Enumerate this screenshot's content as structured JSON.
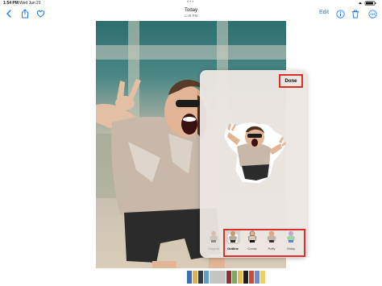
{
  "status_bar": {
    "time": "1:54 PM",
    "date": "Wed Jun 21",
    "right": ""
  },
  "nav": {
    "title": "Today",
    "subtitle": "1:48 PM",
    "edit_label": "Edit",
    "icons": [
      "back-chevron-icon",
      "share-icon",
      "heart-icon",
      "info-icon",
      "trash-icon",
      "more-icon"
    ]
  },
  "sticker_panel": {
    "done_label": "Done",
    "styles": [
      {
        "label": "Original",
        "selected": false
      },
      {
        "label": "Outline",
        "selected": true
      },
      {
        "label": "Comic",
        "selected": false
      },
      {
        "label": "Puffy",
        "selected": false
      },
      {
        "label": "Shiny",
        "selected": false
      }
    ]
  },
  "filmstrip": {
    "thumb_colors": [
      "#3a6fb0",
      "#d7b25a",
      "#2f3a45",
      "#5aa0c8",
      "#c4c4c4",
      "#8f2f2f",
      "#7aa86b",
      "#e0c04e",
      "#1f1f1f",
      "#c84e3a",
      "#6b8fc4",
      "#f0d060"
    ]
  },
  "colors": {
    "accent": "#1a7cf4",
    "highlight": "#d9302c"
  }
}
